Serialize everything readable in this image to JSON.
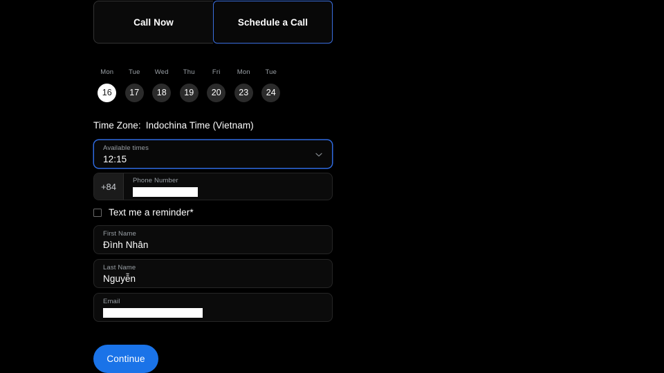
{
  "theme": {
    "background": "#000000",
    "accent_blue": "#1a73e8",
    "focus_border": "#2f6ae0",
    "field_background": "#0b0b0b",
    "field_border": "#262626",
    "muted_text": "#9aa0a6",
    "selected_day_background": "#ffffff",
    "day_background": "#2b2b2b"
  },
  "tabs": [
    {
      "label": "Call Now",
      "selected": false
    },
    {
      "label": "Schedule a Call",
      "selected": true
    }
  ],
  "date_picker": {
    "days": [
      {
        "dow": "Mon",
        "num": "16",
        "selected": true
      },
      {
        "dow": "Tue",
        "num": "17",
        "selected": false
      },
      {
        "dow": "Wed",
        "num": "18",
        "selected": false
      },
      {
        "dow": "Thu",
        "num": "19",
        "selected": false
      },
      {
        "dow": "Fri",
        "num": "20",
        "selected": false
      },
      {
        "dow": "Mon",
        "num": "23",
        "selected": false
      },
      {
        "dow": "Tue",
        "num": "24",
        "selected": false
      }
    ]
  },
  "timezone": {
    "label": "Time Zone:",
    "value": "Indochina Time (Vietnam)"
  },
  "available_times": {
    "label": "Available times",
    "value": "12:15",
    "chevron_icon": "chevron-down-icon"
  },
  "phone": {
    "country_code": "+84",
    "label": "Phone Number",
    "value": "",
    "redacted": true
  },
  "reminder": {
    "label": "Text me a reminder*",
    "checked": false
  },
  "first_name": {
    "label": "First Name",
    "value": "Đình Nhân"
  },
  "last_name": {
    "label": "Last Name",
    "value": "Nguyễn"
  },
  "email": {
    "label": "Email",
    "value": "",
    "redacted": true
  },
  "continue_button": {
    "label": "Continue"
  }
}
